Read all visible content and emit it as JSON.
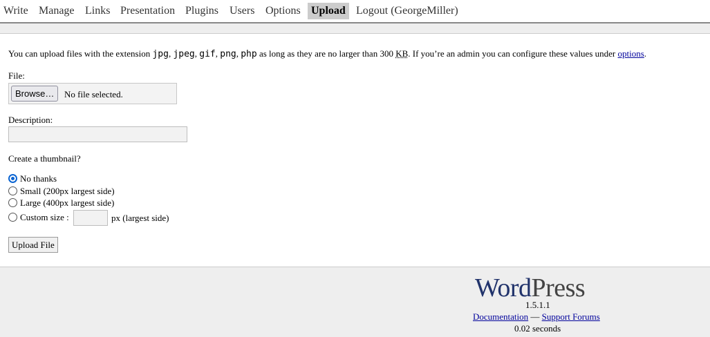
{
  "nav": {
    "items": [
      {
        "label": "Write"
      },
      {
        "label": "Manage"
      },
      {
        "label": "Links"
      },
      {
        "label": "Presentation"
      },
      {
        "label": "Plugins"
      },
      {
        "label": "Users"
      },
      {
        "label": "Options"
      },
      {
        "label": "Upload"
      },
      {
        "label": "Logout (GeorgeMiller)"
      }
    ],
    "active": "Upload"
  },
  "intro": {
    "prefix": "You can upload files with the extension",
    "extensions": [
      "jpg",
      "jpeg",
      "gif",
      "png",
      "php"
    ],
    "middle": "as long as they are no larger than 300",
    "unit": "KB",
    "suffix": ". If you’re an admin you can configure these values under",
    "options_link": "options",
    "end": "."
  },
  "form": {
    "file_label": "File:",
    "browse_label": "Browse…",
    "no_file_text": "No file selected.",
    "description_label": "Description:",
    "description_value": "",
    "thumbnail_question": "Create a thumbnail?",
    "options": [
      {
        "label": "No thanks",
        "checked": true
      },
      {
        "label": "Small (200px largest side)",
        "checked": false
      },
      {
        "label": "Large (400px largest side)",
        "checked": false
      },
      {
        "label": "Custom size :",
        "checked": false
      }
    ],
    "custom_size_value": "",
    "custom_size_unit": "px (largest side)",
    "submit_label": "Upload File"
  },
  "footer": {
    "logo_part1": "Word",
    "logo_part2": "Press",
    "version": "1.5.1.1",
    "documentation_link": "Documentation",
    "separator": "—",
    "support_link": "Support Forums",
    "timing": "0.02 seconds"
  }
}
